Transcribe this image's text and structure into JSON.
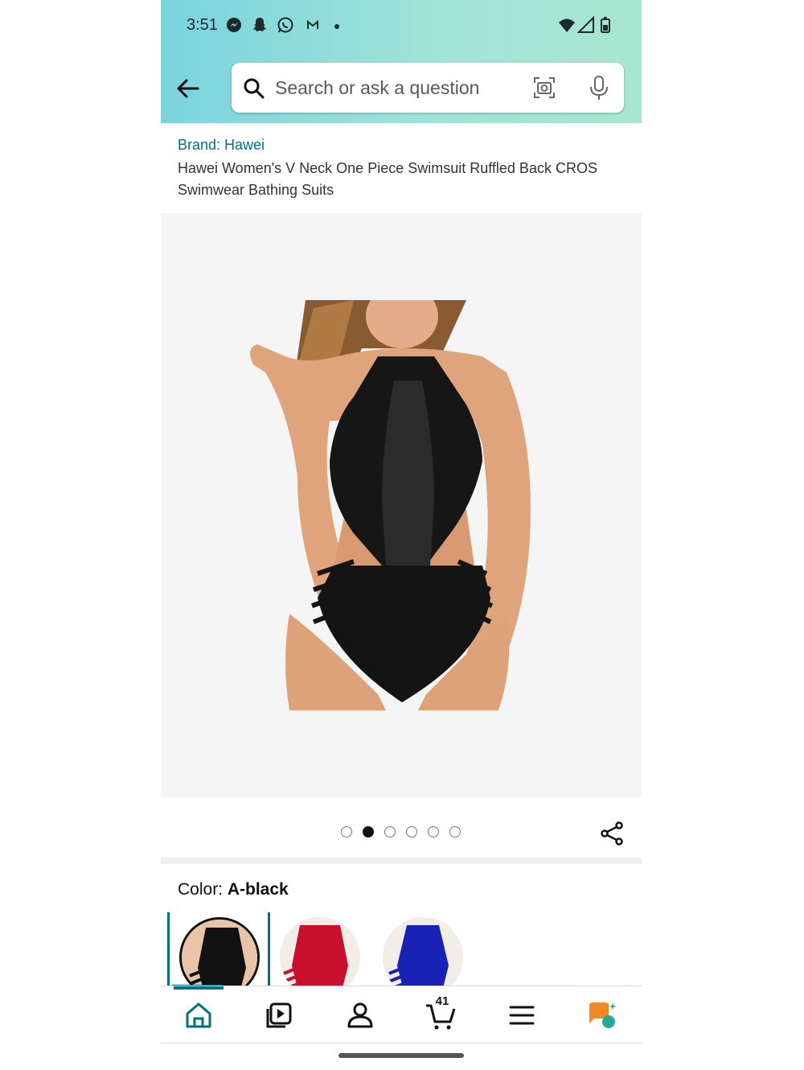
{
  "status_bar": {
    "time": "3:51"
  },
  "search": {
    "placeholder": "Search or ask a question"
  },
  "product": {
    "brand": "Brand: Hawei",
    "title": "Hawei Women's V Neck One Piece Swimsuit Ruffled Back CROS Swimwear Bathing Suits"
  },
  "carousel": {
    "image_count": 6,
    "active_index": 1
  },
  "color": {
    "label": "Color: ",
    "selected": "A-black",
    "options": [
      {
        "name": "black",
        "swatch": "#111111"
      },
      {
        "name": "red",
        "swatch": "#c8102e"
      },
      {
        "name": "blue",
        "swatch": "#1a22b5"
      }
    ]
  },
  "bottom_nav": {
    "items": [
      "home",
      "video",
      "account",
      "cart",
      "menu",
      "rufus"
    ],
    "cart_count": "41"
  },
  "colors": {
    "accent": "#007185",
    "header_start": "#7ad3dd",
    "header_end": "#a8e6cf",
    "rufus_orange": "#f08a24"
  }
}
